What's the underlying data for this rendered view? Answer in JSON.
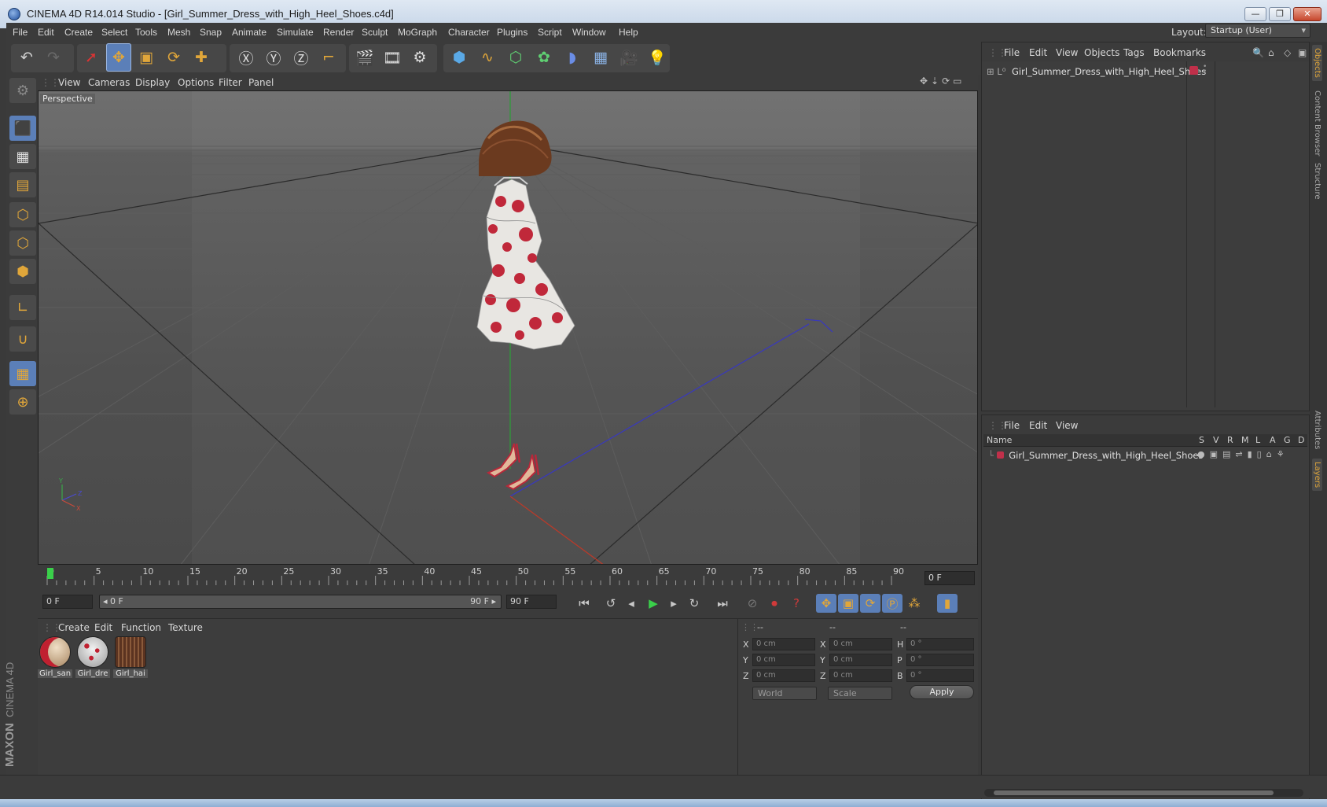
{
  "window": {
    "title": "CINEMA 4D R14.014 Studio - [Girl_Summer_Dress_with_High_Heel_Shoes.c4d]",
    "minimize": "—",
    "restore": "❐",
    "close": "✕"
  },
  "menubar": [
    "File",
    "Edit",
    "Create",
    "Select",
    "Tools",
    "Mesh",
    "Snap",
    "Animate",
    "Simulate",
    "Render",
    "Sculpt",
    "MoGraph",
    "Character",
    "Plugins",
    "Script",
    "Window",
    "Help"
  ],
  "layout": {
    "label": "Layout:",
    "value": "Startup (User)"
  },
  "viewport": {
    "menu": [
      "View",
      "Cameras",
      "Display",
      "Options",
      "Filter",
      "Panel"
    ],
    "camera_label": "Perspective"
  },
  "timeline": {
    "ticks": [
      "0",
      "5",
      "10",
      "15",
      "20",
      "25",
      "30",
      "35",
      "40",
      "45",
      "50",
      "55",
      "60",
      "65",
      "70",
      "75",
      "80",
      "85",
      "90"
    ],
    "current_frame": "0 F"
  },
  "transport": {
    "start": "0 F",
    "range_start": "◂ 0 F",
    "range_end": "90 F ▸",
    "end": "90 F"
  },
  "materials": {
    "menu": [
      "Create",
      "Edit",
      "Function",
      "Texture"
    ],
    "items": [
      "Girl_san",
      "Girl_dre",
      "Girl_hai"
    ]
  },
  "coords": {
    "headers": [
      "--",
      "--",
      "--"
    ],
    "pos_labels": [
      "X",
      "Y",
      "Z"
    ],
    "size_labels": [
      "X",
      "Y",
      "Z"
    ],
    "rot_labels": [
      "H",
      "P",
      "B"
    ],
    "pos_values": [
      "0 cm",
      "0 cm",
      "0 cm"
    ],
    "size_values": [
      "0 cm",
      "0 cm",
      "0 cm"
    ],
    "rot_values": [
      "0 °",
      "0 °",
      "0 °"
    ],
    "mode": "World",
    "transform": "Scale",
    "apply": "Apply"
  },
  "object_manager": {
    "menu": [
      "File",
      "Edit",
      "View",
      "Objects",
      "Tags",
      "Bookmarks"
    ],
    "object": "Girl_Summer_Dress_with_High_Heel_Shoes"
  },
  "layer_manager": {
    "menu": [
      "File",
      "Edit",
      "View"
    ],
    "columns": [
      "Name",
      "S",
      "V",
      "R",
      "M",
      "L",
      "A",
      "G",
      "D"
    ],
    "layer": "Girl_Summer_Dress_with_High_Heel_Shoes"
  },
  "side_tabs": [
    "Objects",
    "Content Browser",
    "Structure",
    "Attributes",
    "Layers"
  ],
  "brand": {
    "maxon": "MAXON",
    "product": "CINEMA 4D"
  },
  "colors": {
    "accent_orange": "#e0a63a",
    "selected_blue": "#5b7fb8",
    "layer_red": "#c0304a"
  }
}
